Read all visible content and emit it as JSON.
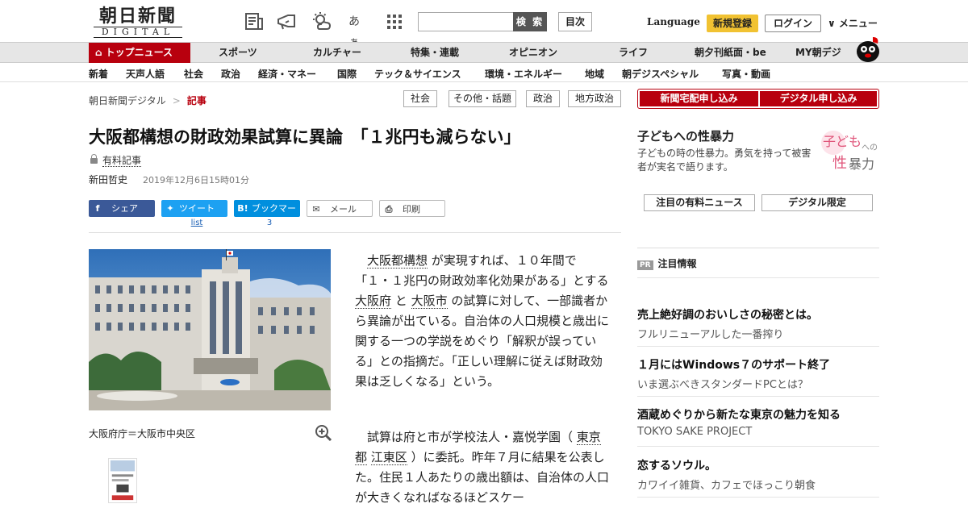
{
  "header": {
    "logo_main": "朝日新聞",
    "logo_sub": "DIGITAL",
    "icons": [
      "newspaper-icon",
      "megaphone-icon",
      "weather-icon",
      "font-size-icon",
      "grid-menu-icon"
    ],
    "font_size_glyph": "あぁ",
    "search_placeholder": "",
    "search_button": "検 索",
    "toc_button": "目次",
    "language": "Language",
    "register": "新規登録",
    "login": "ログイン",
    "menu": "∨ メニュー"
  },
  "nav": {
    "top": "トップニュース",
    "items": [
      "スポーツ",
      "カルチャー",
      "特集・連載",
      "オピニオン",
      "ライフ",
      "朝夕刊紙面・be",
      "MY朝デジ"
    ]
  },
  "subnav": [
    "新着",
    "天声人語",
    "社会",
    "政治",
    "経済・マネー",
    "国際",
    "テック＆サイエンス",
    "環境・エネルギー",
    "地域",
    "朝デジスペシャル",
    "写真・動画"
  ],
  "breadcrumb": {
    "home": "朝日新聞デジタル",
    "sep": ">",
    "current": "記事"
  },
  "tags": [
    "社会",
    "その他・話題",
    "政治",
    "地方政治"
  ],
  "article": {
    "title": "大阪都構想の財政効果試算に異論　「１兆円も減らない」",
    "paid": "有料記事",
    "author": "新田哲史",
    "date": "2019年12月6日15時01分",
    "share": {
      "facebook": "シェア",
      "twitter": "ツイート",
      "twitter_count": "list",
      "hatena": "ブックマーク",
      "hatena_icon": "B!",
      "hatena_count": "3",
      "mail": "メール",
      "print": "印刷"
    },
    "caption": "大阪府庁＝大阪市中央区",
    "p1": {
      "l1": "大阪都構想",
      "t1": " が実現すれば、１０年間で「１・１兆円の財政効率化効果がある」とする ",
      "l2": "大阪府",
      "t2": " と ",
      "l3": "大阪市",
      "t3": " の試算に対して、一部識者から異論が出ている。自治体の人口規模と歳出に関する一つの学説をめぐり「解釈が誤っている」との指摘だ。「正しい理解に従えば財政効果は乏しくなる」という。"
    },
    "p2": {
      "t1": "試算は府と市が学校法人・嘉悦学園（ ",
      "l1": "東京都",
      "t2": " ",
      "l2": "江東区",
      "t3": " ）に委託。昨年７月に結果を公表した。住民１人あたりの歳出額は、自治体の人口が大きくなればなるほどスケー"
    }
  },
  "sidebar": {
    "subscribe_paper": "新聞宅配申し込み",
    "subscribe_digital": "デジタル申し込み",
    "feature_title": "子どもへの性暴力",
    "feature_desc": "子どもの時の性暴力。勇気を持って被害者が実名で語ります。",
    "feature_logo_a": "子ども",
    "feature_logo_b": "への",
    "feature_logo_c": "性",
    "feature_logo_d": "暴力",
    "pill1": "注目の有料ニュース",
    "pill2": "デジタル限定",
    "pr_badge": "PR",
    "pr_heading": "注目情報",
    "pr_items": [
      {
        "title": "売上絶好調のおいしさの秘密とは。",
        "sub": "フルリニューアルした一番搾り"
      },
      {
        "title": "１月にはWindows７のサポート終了",
        "sub": "いま選ぶべきスタンダードPCとは？"
      },
      {
        "title": "酒蔵めぐりから新たな東京の魅力を知る",
        "sub": "TOKYO SAKE PROJECT"
      },
      {
        "title": "恋するソウル。",
        "sub": "カワイイ雑貨、カフェでほっこり朝食"
      }
    ]
  },
  "colors": {
    "brand_red": "#b8000e",
    "register_yellow": "#f1c232",
    "facebook": "#3b5998",
    "twitter": "#1da1f2",
    "hatena": "#008fde"
  }
}
